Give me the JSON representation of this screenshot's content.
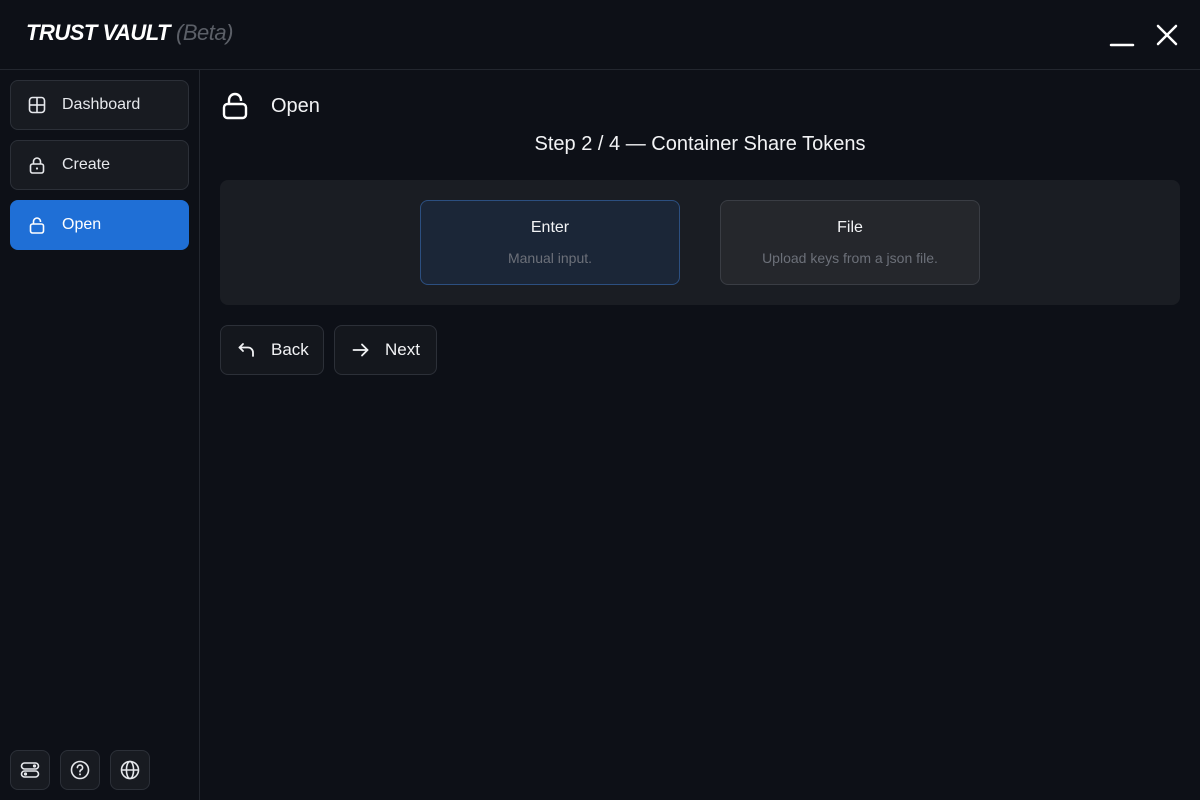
{
  "app": {
    "title": "TRUST VAULT",
    "badge": "(Beta)"
  },
  "window_controls": {
    "minimize_icon": "minimize-icon",
    "close_icon": "close-icon"
  },
  "sidebar": {
    "items": [
      {
        "label": "Dashboard",
        "icon": "grid-icon",
        "active": false
      },
      {
        "label": "Create",
        "icon": "lock-icon",
        "active": false
      },
      {
        "label": "Open",
        "icon": "unlock-icon",
        "active": true
      }
    ],
    "tools": [
      {
        "icon": "settings-toggle-icon"
      },
      {
        "icon": "help-icon"
      },
      {
        "icon": "globe-icon"
      }
    ]
  },
  "main": {
    "page_title": "Open",
    "page_icon": "unlock-icon",
    "step_title": "Step 2 / 4 — Container Share Tokens",
    "options": [
      {
        "title": "Enter",
        "description": "Manual input.",
        "selected": true
      },
      {
        "title": "File",
        "description": "Upload keys from a json file.",
        "selected": false
      }
    ],
    "buttons": {
      "back": "Back",
      "next": "Next"
    }
  },
  "colors": {
    "background": "#0d1017",
    "accent": "#1f6fd6",
    "panel": "#1a1d23",
    "selected_card": "#1b2637"
  }
}
